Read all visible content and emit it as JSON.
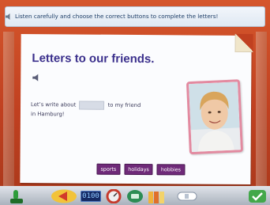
{
  "instruction": {
    "text": "Listen carefully and choose the correct buttons to complete the letters!"
  },
  "lesson": {
    "title": "Letters to our friends.",
    "sentence_before": "Let’s write about",
    "sentence_after": "to my friend",
    "sentence_line2": "in Hamburg!"
  },
  "options": [
    {
      "label": "sports"
    },
    {
      "label": "holidays"
    },
    {
      "label": "hobbies"
    }
  ],
  "toolbar": {
    "time": "0100"
  },
  "colors": {
    "title": "#3a2f8c",
    "option_bg": "#6f2a79",
    "photo_border": "#e38aa0",
    "frame": "#c0441f"
  }
}
